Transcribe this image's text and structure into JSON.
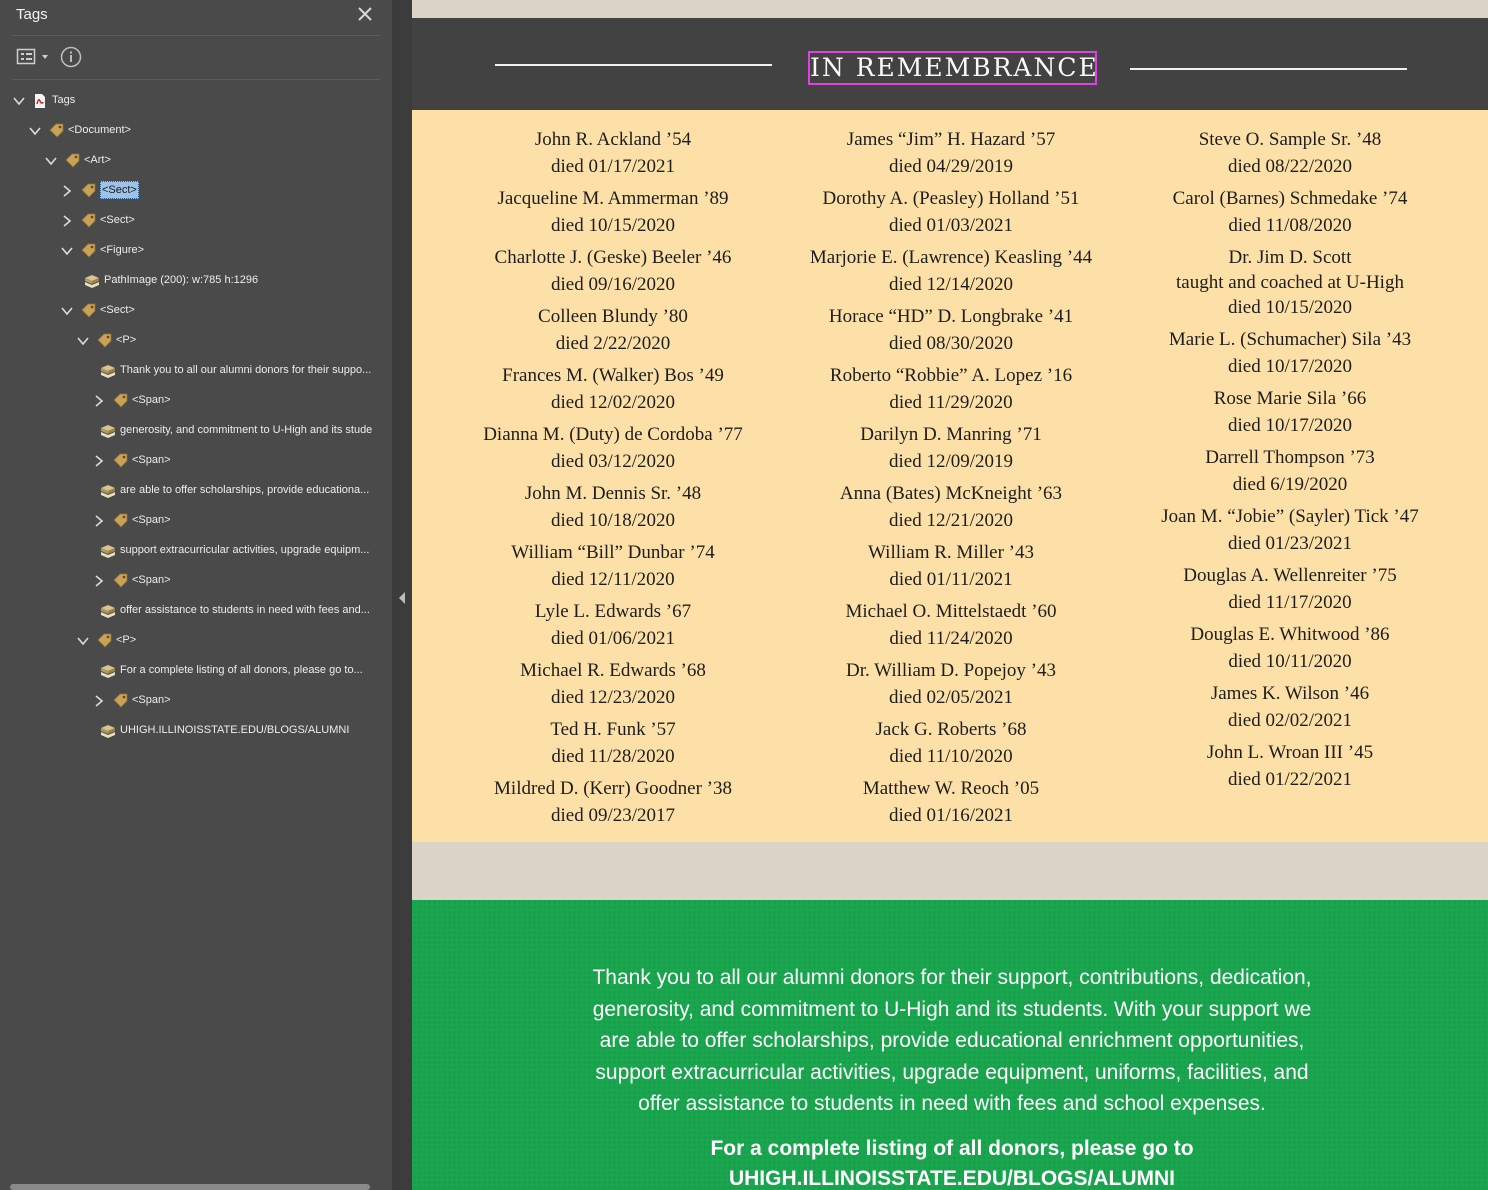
{
  "panel": {
    "title": "Tags",
    "tree": [
      {
        "label": "Tags",
        "icon": "pdf-icon",
        "depth": 0,
        "expanded": true
      },
      {
        "label": "<Document>",
        "icon": "tag-icon",
        "depth": 1,
        "expanded": true
      },
      {
        "label": "<Art>",
        "icon": "tag-icon",
        "depth": 2,
        "expanded": true
      },
      {
        "label": "<Sect>",
        "icon": "tag-icon",
        "depth": 3,
        "expanded": false,
        "selected": true
      },
      {
        "label": "<Sect>",
        "icon": "tag-icon",
        "depth": 3,
        "expanded": false
      },
      {
        "label": "<Figure>",
        "icon": "tag-icon",
        "depth": 3,
        "expanded": true
      },
      {
        "label": "PathImage (200): w:785 h:1296",
        "icon": "content-icon",
        "depth": 4
      },
      {
        "label": "<Sect>",
        "icon": "tag-icon",
        "depth": 3,
        "expanded": true
      },
      {
        "label": "<P>",
        "icon": "tag-icon",
        "depth": 4,
        "expanded": true
      },
      {
        "label": "Thank you to all our alumni donors for their suppo...",
        "icon": "content-icon",
        "depth": 5
      },
      {
        "label": "<Span>",
        "icon": "tag-icon",
        "depth": 5,
        "expanded": false
      },
      {
        "label": "generosity, and commitment to U-High and its stude",
        "icon": "content-icon",
        "depth": 5
      },
      {
        "label": "<Span>",
        "icon": "tag-icon",
        "depth": 5,
        "expanded": false
      },
      {
        "label": "are able to offer scholarships, provide educationa...",
        "icon": "content-icon",
        "depth": 5
      },
      {
        "label": "<Span>",
        "icon": "tag-icon",
        "depth": 5,
        "expanded": false
      },
      {
        "label": "support extracurricular activities, upgrade equipm...",
        "icon": "content-icon",
        "depth": 5
      },
      {
        "label": "<Span>",
        "icon": "tag-icon",
        "depth": 5,
        "expanded": false
      },
      {
        "label": "offer assistance to students in need with fees and...",
        "icon": "content-icon",
        "depth": 5
      },
      {
        "label": "<P>",
        "icon": "tag-icon",
        "depth": 4,
        "expanded": true
      },
      {
        "label": "For a complete listing of all donors, please go to...",
        "icon": "content-icon",
        "depth": 5
      },
      {
        "label": "<Span>",
        "icon": "tag-icon",
        "depth": 5,
        "expanded": false
      },
      {
        "label": "UHIGH.ILLINOISSTATE.EDU/BLOGS/ALUMNI",
        "icon": "content-icon",
        "depth": 5
      }
    ]
  },
  "document": {
    "section_title": "IN REMEMBRANCE",
    "columns": [
      [
        {
          "name": "John R. Ackland ’54",
          "died": "died 01/17/2021"
        },
        {
          "name": "Jacqueline M. Ammerman ’89",
          "died": "died 10/15/2020"
        },
        {
          "name": "Charlotte J. (Geske) Beeler ’46",
          "died": "died 09/16/2020"
        },
        {
          "name": "Colleen Blundy ’80",
          "died": "died 2/22/2020"
        },
        {
          "name": "Frances M. (Walker) Bos ’49",
          "died": "died 12/02/2020"
        },
        {
          "name": "Dianna M. (Duty) de Cordoba ’77",
          "died": "died 03/12/2020"
        },
        {
          "name": "John M. Dennis Sr. ’48",
          "died": "died 10/18/2020"
        },
        {
          "name": "William “Bill” Dunbar ’74",
          "died": "died 12/11/2020"
        },
        {
          "name": "Lyle L. Edwards ’67",
          "died": "died 01/06/2021"
        },
        {
          "name": "Michael R. Edwards ’68",
          "died": "died 12/23/2020"
        },
        {
          "name": "Ted H. Funk ’57",
          "died": "died 11/28/2020"
        },
        {
          "name": "Mildred D. (Kerr) Goodner ’38",
          "died": "died 09/23/2017"
        }
      ],
      [
        {
          "name": "James “Jim” H. Hazard ’57",
          "died": "died 04/29/2019"
        },
        {
          "name": "Dorothy A. (Peasley) Holland ’51",
          "died": "died 01/03/2021"
        },
        {
          "name": "Marjorie E. (Lawrence) Keasling ’44",
          "died": "died 12/14/2020"
        },
        {
          "name": "Horace “HD” D. Longbrake ’41",
          "died": "died 08/30/2020"
        },
        {
          "name": "Roberto “Robbie” A. Lopez ’16",
          "died": "died 11/29/2020"
        },
        {
          "name": "Darilyn D. Manring ’71",
          "died": "died 12/09/2019"
        },
        {
          "name": "Anna (Bates) McKneight ’63",
          "died": "died 12/21/2020"
        },
        {
          "name": "William R. Miller ’43",
          "died": "died 01/11/2021"
        },
        {
          "name": "Michael O. Mittelstaedt ’60",
          "died": "died 11/24/2020"
        },
        {
          "name": "Dr. William D. Popejoy ’43",
          "died": "died 02/05/2021"
        },
        {
          "name": "Jack G. Roberts ’68",
          "died": "died 11/10/2020"
        },
        {
          "name": "Matthew W. Reoch ’05",
          "died": "died 01/16/2021"
        }
      ],
      [
        {
          "name": "Steve O. Sample Sr. ’48",
          "died": "died 08/22/2020"
        },
        {
          "name": "Carol (Barnes) Schmedake ’74",
          "died": "died 11/08/2020"
        },
        {
          "name": "Dr. Jim D. Scott",
          "note": "taught and coached at U-High",
          "died": "died 10/15/2020"
        },
        {
          "name": "Marie L. (Schumacher) Sila ’43",
          "died": "died 10/17/2020"
        },
        {
          "name": "Rose Marie Sila ’66",
          "died": "died 10/17/2020"
        },
        {
          "name": "Darrell Thompson ’73",
          "died": "died 6/19/2020"
        },
        {
          "name": "Joan M. “Jobie” (Sayler) Tick ’47",
          "died": "died 01/23/2021"
        },
        {
          "name": "Douglas A. Wellenreiter ’75",
          "died": "died 11/17/2020"
        },
        {
          "name": "Douglas E. Whitwood ’86",
          "died": "died 10/11/2020"
        },
        {
          "name": "James K. Wilson ’46",
          "died": "died 02/02/2021"
        },
        {
          "name": "John L. Wroan III ’45",
          "died": "died 01/22/2021"
        }
      ]
    ],
    "thanks_lines": [
      "Thank you to all our alumni donors for their support, contributions, dedication,",
      "generosity, and commitment to U-High and its students. With your support we",
      "are able to offer scholarships, provide educational enrichment opportunities,",
      "support extracurricular activities, upgrade equipment, uniforms, facilities, and",
      "offer assistance to students in need with fees and school expenses."
    ],
    "listing_line": "For a complete listing of all donors, please go to",
    "listing_url": "UHIGH.ILLINOISSTATE.EDU/BLOGS/ALUMNI"
  },
  "colors": {
    "panel_bg": "#4a4a4a",
    "selection": "#9fc3e8",
    "dark_band": "#424242",
    "memorial_bg": "#fde0a8",
    "green": "#1aa64e",
    "highlight_border": "#e040e0"
  }
}
